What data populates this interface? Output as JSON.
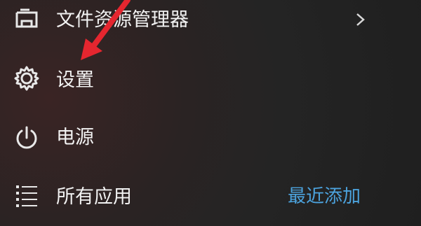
{
  "start_menu": {
    "items": [
      {
        "label": "文件资源管理器",
        "icon": "file-explorer-icon",
        "has_submenu": true
      },
      {
        "label": "设置",
        "icon": "gear-icon"
      },
      {
        "label": "电源",
        "icon": "power-icon"
      },
      {
        "label": "所有应用",
        "icon": "list-icon",
        "secondary_link": "最近添加"
      }
    ]
  },
  "colors": {
    "text": "#f2f2f2",
    "accent_link": "#4ca3de",
    "annotation_arrow": "#e5262f"
  }
}
